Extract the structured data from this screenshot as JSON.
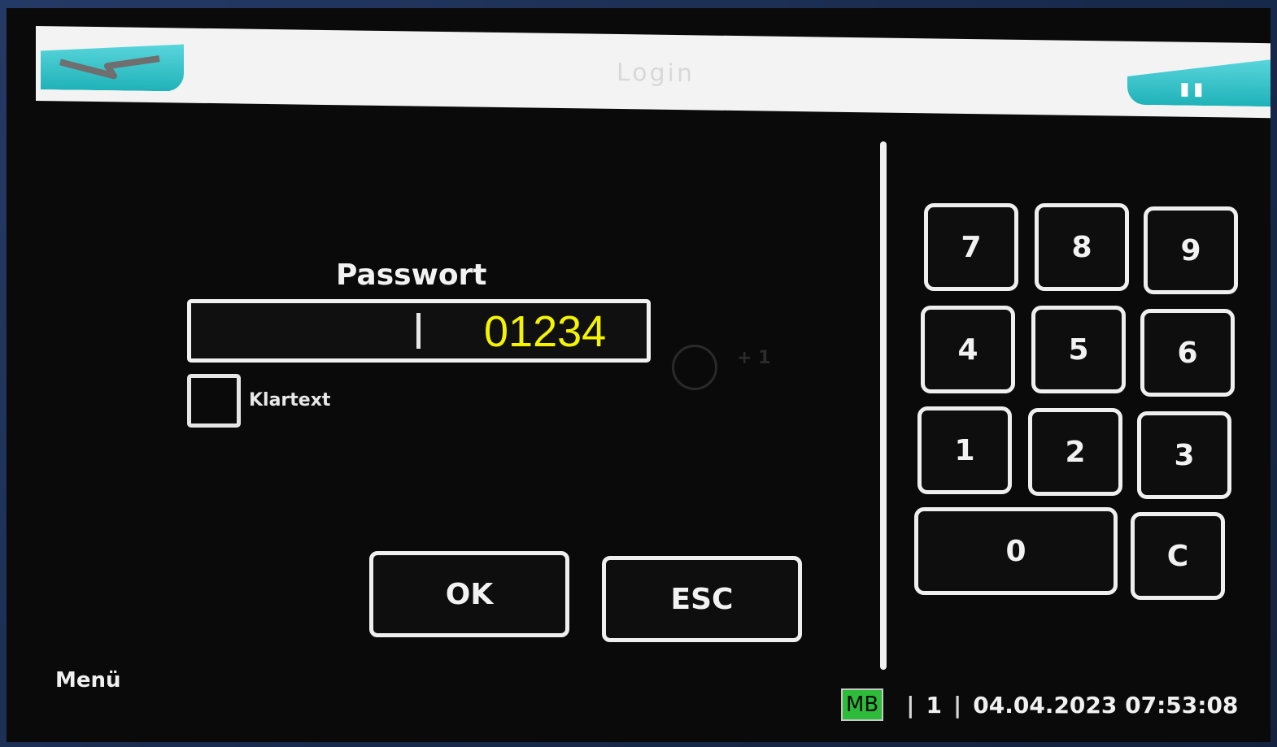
{
  "header": {
    "title": "Login",
    "back_icon": "back-arrow-icon",
    "home_icon": "home-icon",
    "home_glyph": "ꟷꟷ",
    "accent_color": "#29c2c8"
  },
  "login": {
    "password_label": "Passwort",
    "password_value": "01234",
    "cleartext_label": "Klartext",
    "ghost_text": "+ 1"
  },
  "buttons": {
    "ok": "OK",
    "esc": "ESC"
  },
  "keypad": {
    "keys": [
      "7",
      "8",
      "9",
      "4",
      "5",
      "6",
      "1",
      "2",
      "3",
      "0",
      "C"
    ]
  },
  "footer": {
    "menu_label": "Menü",
    "mb_badge": "MB",
    "sep": "|",
    "counter": "1",
    "datetime": "04.04.2023 07:53:08",
    "badge_color": "#2dbb3a"
  }
}
